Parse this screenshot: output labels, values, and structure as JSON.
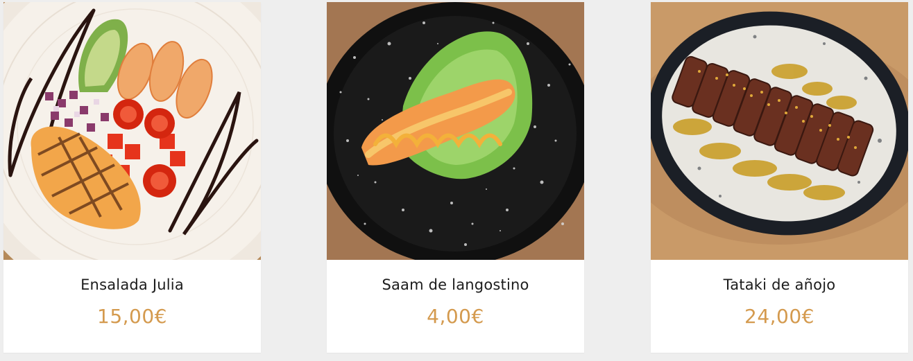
{
  "colors": {
    "page_background": "#eeeeee",
    "card_background": "#ffffff",
    "name_text": "#1c1c1c",
    "price_accent": "#d49a4e"
  },
  "products": [
    {
      "name": "Ensalada Julia",
      "price": "15,00€",
      "image": "salad-plate-image"
    },
    {
      "name": "Saam de langostino",
      "price": "4,00€",
      "image": "prawn-lettuce-image"
    },
    {
      "name": "Tataki de añojo",
      "price": "24,00€",
      "image": "beef-tataki-image"
    }
  ]
}
